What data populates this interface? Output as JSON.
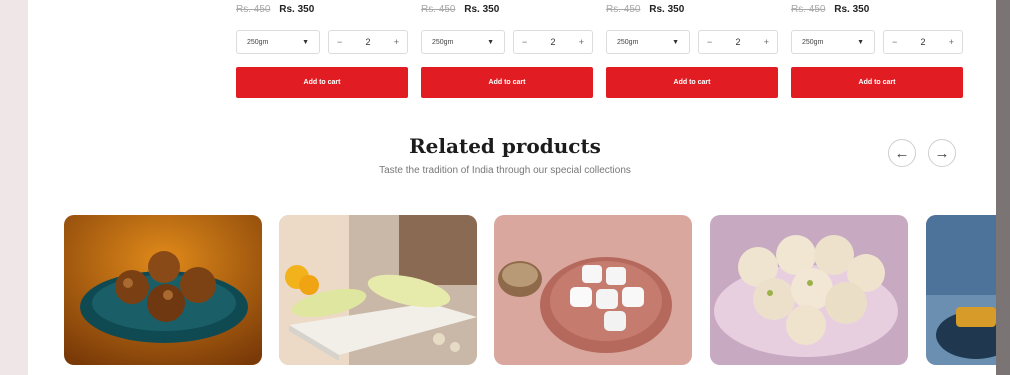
{
  "products": [
    {
      "old_price": "Rs. 450",
      "new_price": "Rs. 350",
      "weight": "250gm",
      "quantity": "2",
      "minus": "−",
      "plus": "+",
      "add_label": "Add to cart"
    },
    {
      "old_price": "Rs. 450",
      "new_price": "Rs. 350",
      "weight": "250gm",
      "quantity": "2",
      "minus": "−",
      "plus": "+",
      "add_label": "Add to cart"
    },
    {
      "old_price": "Rs. 450",
      "new_price": "Rs. 350",
      "weight": "250gm",
      "quantity": "2",
      "minus": "−",
      "plus": "+",
      "add_label": "Add to cart"
    },
    {
      "old_price": "Rs. 450",
      "new_price": "Rs. 350",
      "weight": "250gm",
      "quantity": "2",
      "minus": "−",
      "plus": "+",
      "add_label": "Add to cart"
    }
  ],
  "related": {
    "title": "Related products",
    "subtitle": "Taste the tradition of India through our special collections",
    "prev_icon": "←",
    "next_icon": "→"
  },
  "colors": {
    "accent": "#e11d23",
    "background": "#efe6e7"
  },
  "icons": [
    "chevron-down-icon",
    "arrow-left-icon",
    "arrow-right-icon"
  ]
}
